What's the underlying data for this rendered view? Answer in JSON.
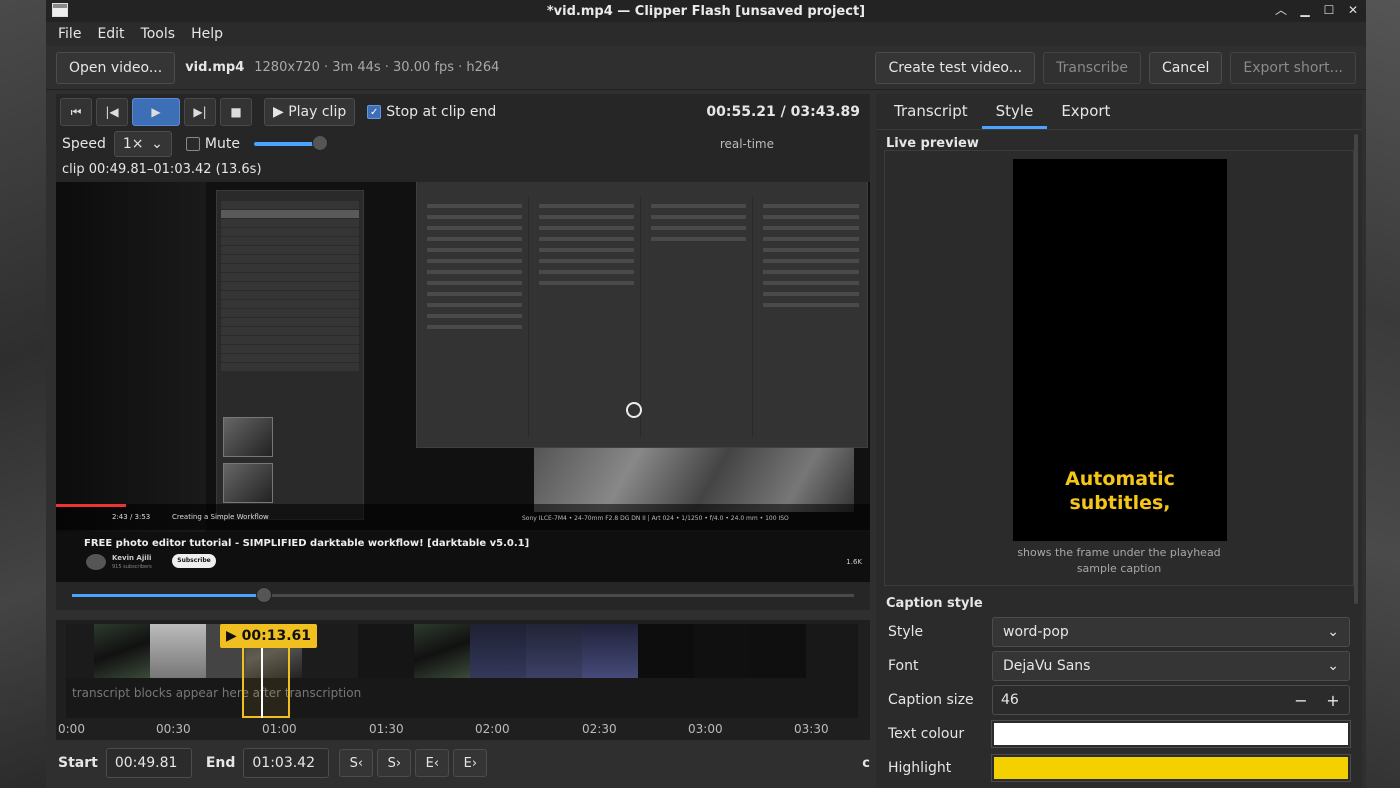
{
  "window": {
    "title": "*vid.mp4 — Clipper Flash  [unsaved project]"
  },
  "menu": [
    "File",
    "Edit",
    "Tools",
    "Help"
  ],
  "toolbar": {
    "open_video": "Open video...",
    "file_name": "vid.mp4",
    "file_meta": "1280x720 · 3m 44s · 30.00 fps · h264",
    "create_test": "Create test video...",
    "transcribe": "Transcribe",
    "cancel": "Cancel",
    "export_short": "Export short..."
  },
  "player": {
    "play_clip": "▶ Play clip",
    "stop_at_clip_end": "Stop at clip end",
    "stop_at_clip_end_checked": true,
    "timecode": "00:55.21 / 03:43.89",
    "speed_label": "Speed",
    "speed_value": "1×",
    "mute_label": "Mute",
    "mute_checked": false,
    "volume_fraction": 0.85,
    "realtime": "real-time",
    "clip_info": "clip 00:49.81–01:03.42  (13.6s)",
    "scrub_fraction": 0.25
  },
  "video_frame": {
    "title": "FREE photo editor tutorial - SIMPLIFIED darktable workflow! [darktable v5.0.1]",
    "channel": "Kevin Ajili",
    "subscribers": "915 subscribers",
    "subscribe": "Subscribe",
    "likes": "1.6K",
    "time": "2:43 / 3:53",
    "chapter": "Creating a Simple Workflow",
    "camera": "Sony ILCE-7M4 • 24-70mm F2.8 DG DN II | Art 024 • 1/1250 • f/4.0 • 24.0 mm • 100 ISO"
  },
  "timeline": {
    "playhead_label": "▶ 00:13.61",
    "hint": "transcript blocks appear here after transcription",
    "ticks": [
      "0:00",
      "00:30",
      "01:00",
      "01:30",
      "02:00",
      "02:30",
      "03:00",
      "03:30"
    ]
  },
  "trim": {
    "start_label": "Start",
    "start_value": "00:49.81",
    "end_label": "End",
    "end_value": "01:03.42",
    "buttons": [
      "S‹",
      "S›",
      "E‹",
      "E›"
    ],
    "cut_off": "c"
  },
  "right": {
    "tabs": [
      "Transcript",
      "Style",
      "Export"
    ],
    "active_tab": "Style",
    "live_preview": "Live preview",
    "caption_line1": "Automatic",
    "caption_line2": "subtitles,",
    "preview_note1": "shows the frame under the playhead",
    "preview_note2": "sample caption",
    "caption_style_title": "Caption style",
    "style_label": "Style",
    "style_value": "word-pop",
    "font_label": "Font",
    "font_value": "DejaVu Sans",
    "size_label": "Caption size",
    "size_value": "46",
    "text_colour_label": "Text colour",
    "text_colour": "#ffffff",
    "highlight_label": "Highlight",
    "highlight_colour": "#f5d000"
  },
  "icons": [
    "app-icon",
    "jump-start-icon",
    "prev-frame-icon",
    "play-icon",
    "next-frame-icon",
    "stop-icon",
    "chevron-down-icon",
    "minus-icon",
    "plus-icon"
  ]
}
